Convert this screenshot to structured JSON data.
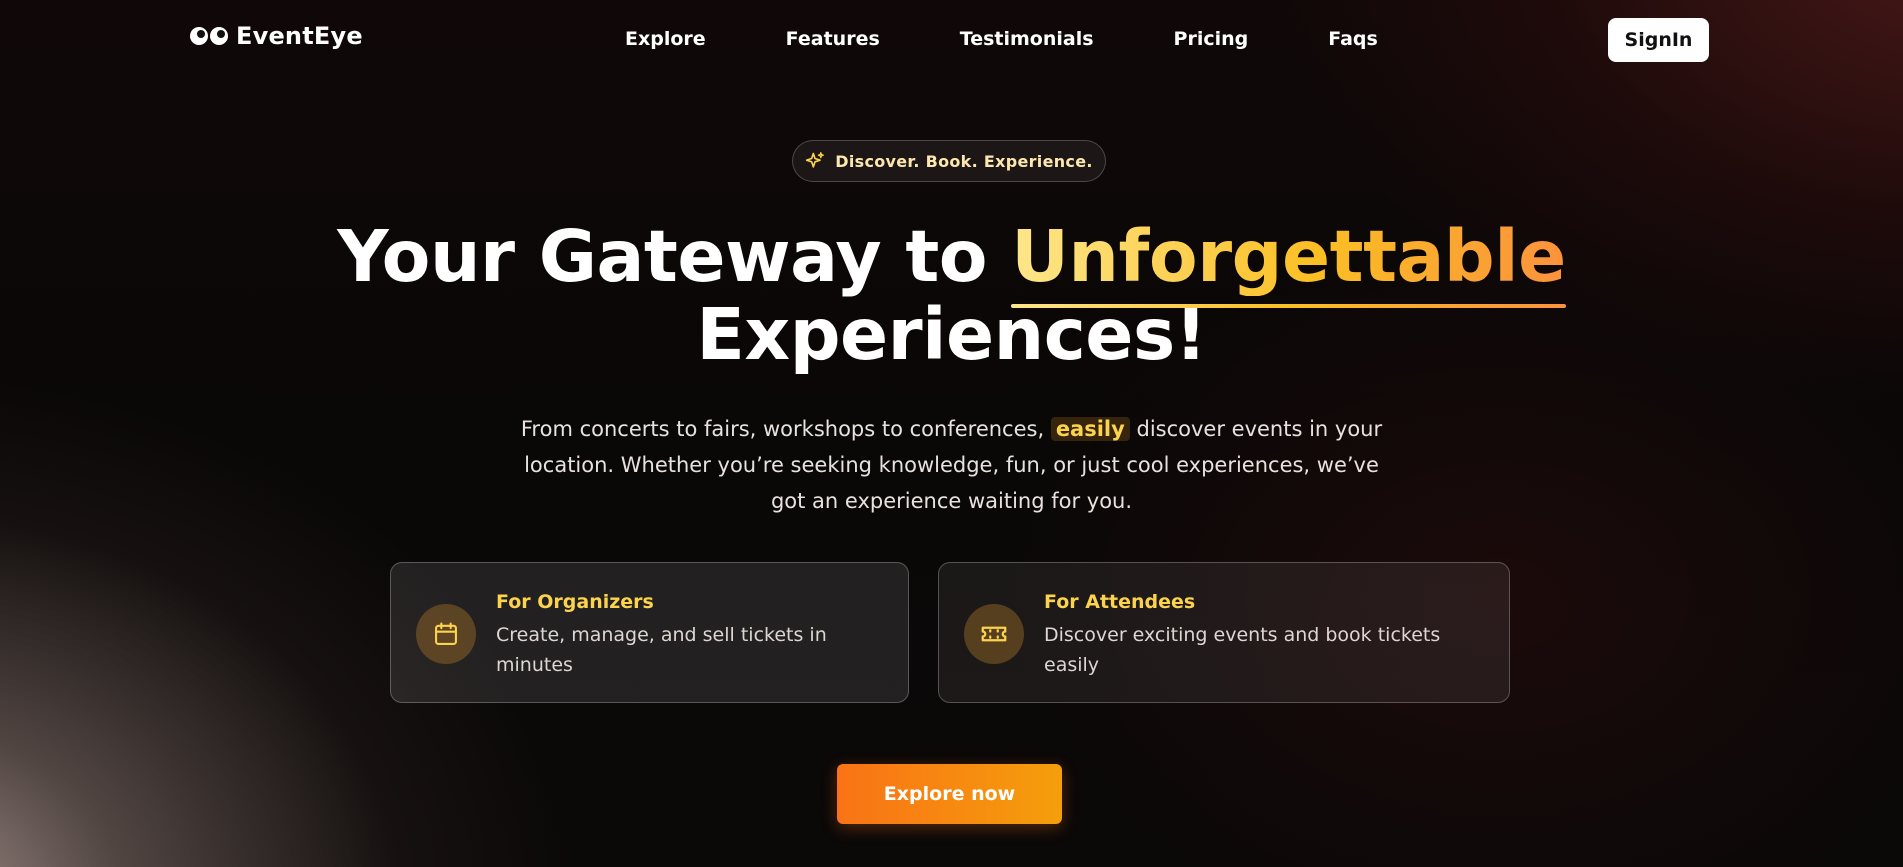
{
  "brand": {
    "name": "EventEye"
  },
  "nav": {
    "links": [
      "Explore",
      "Features",
      "Testimonials",
      "Pricing",
      "Faqs"
    ],
    "signin_label": "SignIn"
  },
  "hero": {
    "badge": "Discover. Book. Experience.",
    "headline_part1": "Your Gateway to ",
    "headline_accent": "Unforgettable",
    "headline_part2": "Experiences!",
    "subtitle_before": "From concerts to fairs, workshops to conferences, ",
    "subtitle_highlight": "easily",
    "subtitle_after": " discover events in your location. Whether you’re seeking knowledge, fun, or just cool experiences, we’ve got an experience waiting for you.",
    "cta_label": "Explore now"
  },
  "cards": [
    {
      "title": "For Organizers",
      "description": "Create, manage, and sell tickets in minutes",
      "icon": "calendar-icon"
    },
    {
      "title": "For Attendees",
      "description": "Discover exciting events and book tickets easily",
      "icon": "ticket-icon"
    }
  ],
  "colors": {
    "accent_start": "#fde68a",
    "accent_end": "#fb923c",
    "cta_start": "#f97316",
    "cta_end": "#f59e0b"
  }
}
